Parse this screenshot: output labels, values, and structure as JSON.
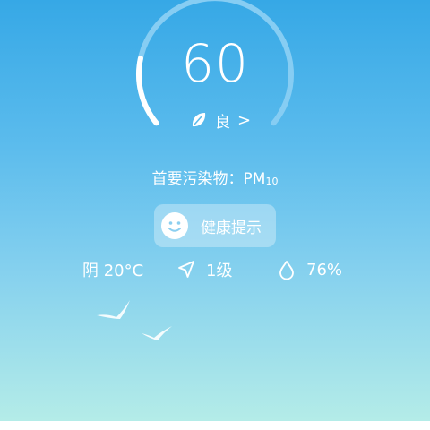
{
  "aqi": {
    "value": "60",
    "level": "良",
    "level_chevron": ">",
    "gauge_fraction": 0.2
  },
  "pollutant": {
    "label": "首要污染物：",
    "name": "PM",
    "subscript": "10"
  },
  "health": {
    "label": "健康提示"
  },
  "stats": {
    "weather": "阴 20°C",
    "wind": "1级",
    "humidity": "76%"
  },
  "icons": {
    "level": "leaf-icon",
    "health": "smile-icon",
    "wind": "wind-direction-icon",
    "humidity": "water-drop-icon"
  },
  "colors": {
    "bg_top": "#36a8e6",
    "bg_bottom": "#b4ece8",
    "gauge_track": "#86cdf3",
    "gauge_progress": "#ffffff"
  }
}
